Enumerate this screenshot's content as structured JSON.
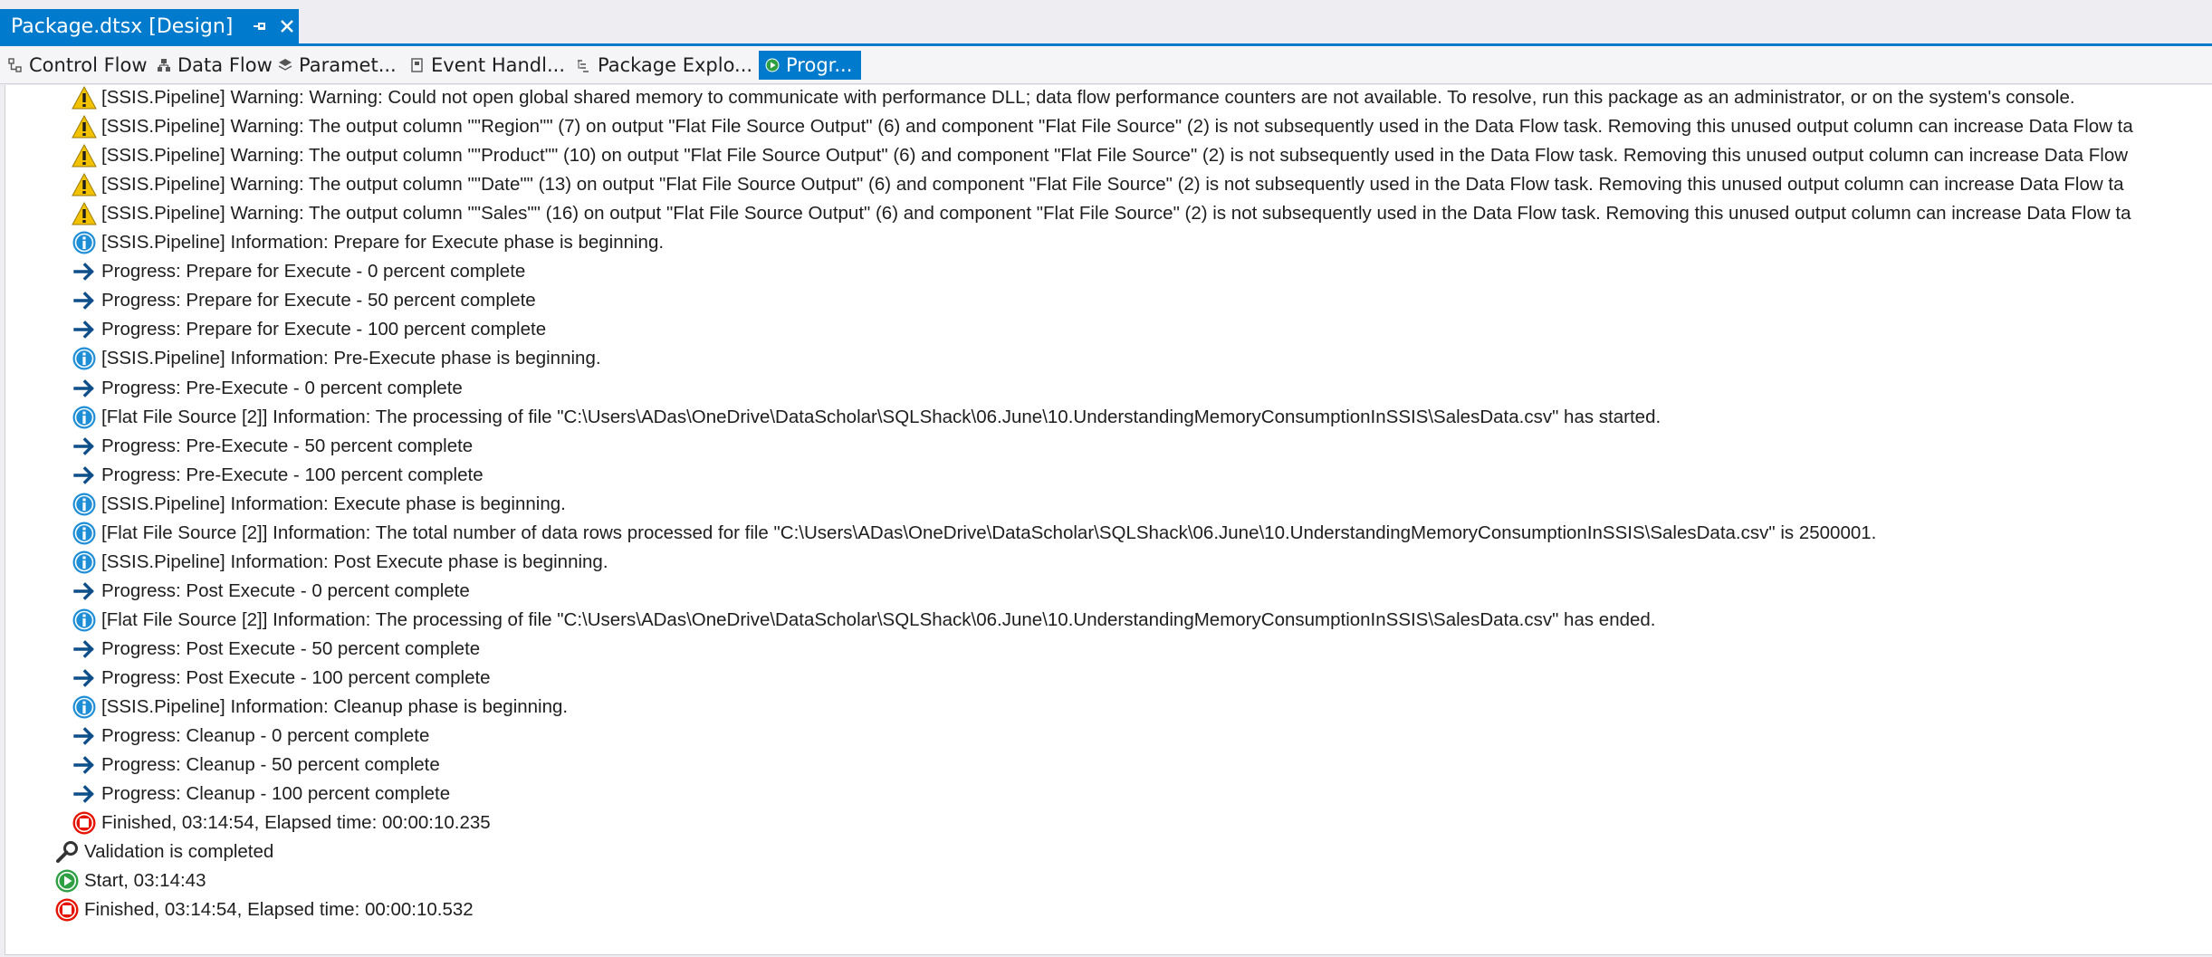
{
  "window": {
    "doc_tab_title": "Package.dtsx [Design]",
    "accent_color": "#007acc"
  },
  "designer_tabs": [
    {
      "label": "Control Flow",
      "icon": "control-flow-icon",
      "active": false
    },
    {
      "label": "Data Flow",
      "icon": "data-flow-icon",
      "active": false
    },
    {
      "label": "Paramet...",
      "icon": "parameters-icon",
      "active": false
    },
    {
      "label": "Event Handl...",
      "icon": "event-handlers-icon",
      "active": false
    },
    {
      "label": "Package Explo...",
      "icon": "package-explorer-icon",
      "active": false
    },
    {
      "label": "Progr...",
      "icon": "progress-icon",
      "active": true
    }
  ],
  "messages": [
    {
      "icon": "warning-icon",
      "indent": 1,
      "text": "[SSIS.Pipeline] Warning: Warning: Could not open global shared memory to communicate with performance DLL; data flow performance counters are not available.  To resolve, run this package as an administrator, or on the system's console."
    },
    {
      "icon": "warning-icon",
      "indent": 1,
      "text": "[SSIS.Pipeline] Warning: The output column \"\"Region\"\" (7) on output \"Flat File Source Output\" (6) and component \"Flat File Source\" (2) is not subsequently used in the Data Flow task. Removing this unused output column can increase Data Flow ta"
    },
    {
      "icon": "warning-icon",
      "indent": 1,
      "text": "[SSIS.Pipeline] Warning: The output column \"\"Product\"\" (10) on output \"Flat File Source Output\" (6) and component \"Flat File Source\" (2) is not subsequently used in the Data Flow task. Removing this unused output column can increase Data Flow"
    },
    {
      "icon": "warning-icon",
      "indent": 1,
      "text": "[SSIS.Pipeline] Warning: The output column \"\"Date\"\" (13) on output \"Flat File Source Output\" (6) and component \"Flat File Source\" (2) is not subsequently used in the Data Flow task. Removing this unused output column can increase Data Flow ta"
    },
    {
      "icon": "warning-icon",
      "indent": 1,
      "text": "[SSIS.Pipeline] Warning: The output column \"\"Sales\"\" (16) on output \"Flat File Source Output\" (6) and component \"Flat File Source\" (2) is not subsequently used in the Data Flow task. Removing this unused output column can increase Data Flow ta"
    },
    {
      "icon": "info-icon",
      "indent": 1,
      "text": "[SSIS.Pipeline] Information: Prepare for Execute phase is beginning."
    },
    {
      "icon": "progress-arrow-icon",
      "indent": 1,
      "text": "Progress: Prepare for Execute - 0 percent complete"
    },
    {
      "icon": "progress-arrow-icon",
      "indent": 1,
      "text": "Progress: Prepare for Execute - 50 percent complete"
    },
    {
      "icon": "progress-arrow-icon",
      "indent": 1,
      "text": "Progress: Prepare for Execute - 100 percent complete"
    },
    {
      "icon": "info-icon",
      "indent": 1,
      "text": "[SSIS.Pipeline] Information: Pre-Execute phase is beginning."
    },
    {
      "icon": "progress-arrow-icon",
      "indent": 1,
      "text": "Progress: Pre-Execute - 0 percent complete"
    },
    {
      "icon": "info-icon",
      "indent": 1,
      "text": "[Flat File Source [2]] Information: The processing of file \"C:\\Users\\ADas\\OneDrive\\DataScholar\\SQLShack\\06.June\\10.UnderstandingMemoryConsumptionInSSIS\\SalesData.csv\" has started."
    },
    {
      "icon": "progress-arrow-icon",
      "indent": 1,
      "text": "Progress: Pre-Execute - 50 percent complete"
    },
    {
      "icon": "progress-arrow-icon",
      "indent": 1,
      "text": "Progress: Pre-Execute - 100 percent complete"
    },
    {
      "icon": "info-icon",
      "indent": 1,
      "text": "[SSIS.Pipeline] Information: Execute phase is beginning."
    },
    {
      "icon": "info-icon",
      "indent": 1,
      "text": "[Flat File Source [2]] Information: The total number of data rows processed for file \"C:\\Users\\ADas\\OneDrive\\DataScholar\\SQLShack\\06.June\\10.UnderstandingMemoryConsumptionInSSIS\\SalesData.csv\" is 2500001."
    },
    {
      "icon": "info-icon",
      "indent": 1,
      "text": "[SSIS.Pipeline] Information: Post Execute phase is beginning."
    },
    {
      "icon": "progress-arrow-icon",
      "indent": 1,
      "text": "Progress: Post Execute - 0 percent complete"
    },
    {
      "icon": "info-icon",
      "indent": 1,
      "text": "[Flat File Source [2]] Information: The processing of file \"C:\\Users\\ADas\\OneDrive\\DataScholar\\SQLShack\\06.June\\10.UnderstandingMemoryConsumptionInSSIS\\SalesData.csv\" has ended."
    },
    {
      "icon": "progress-arrow-icon",
      "indent": 1,
      "text": "Progress: Post Execute - 50 percent complete"
    },
    {
      "icon": "progress-arrow-icon",
      "indent": 1,
      "text": "Progress: Post Execute - 100 percent complete"
    },
    {
      "icon": "info-icon",
      "indent": 1,
      "text": "[SSIS.Pipeline] Information: Cleanup phase is beginning."
    },
    {
      "icon": "progress-arrow-icon",
      "indent": 1,
      "text": "Progress: Cleanup - 0 percent complete"
    },
    {
      "icon": "progress-arrow-icon",
      "indent": 1,
      "text": "Progress: Cleanup - 50 percent complete"
    },
    {
      "icon": "progress-arrow-icon",
      "indent": 1,
      "text": "Progress: Cleanup - 100 percent complete"
    },
    {
      "icon": "finished-stop-icon",
      "indent": 1,
      "text": "Finished, 03:14:54, Elapsed time: 00:00:10.235"
    },
    {
      "icon": "validation-magnifier-icon",
      "indent": 0,
      "text": "Validation is completed"
    },
    {
      "icon": "start-play-icon",
      "indent": 0,
      "text": "Start, 03:14:43"
    },
    {
      "icon": "finished-stop-icon",
      "indent": 0,
      "text": "Finished, 03:14:54, Elapsed time: 00:00:10.532"
    }
  ],
  "colors": {
    "warning": "#f2c200",
    "info": "#1e8fd6",
    "arrow": "#0e4f8a",
    "stop": "#e51400",
    "play": "#2ea043"
  }
}
